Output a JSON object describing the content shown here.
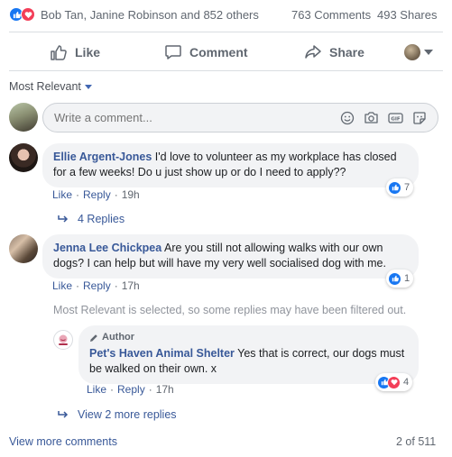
{
  "reactions": {
    "names": "Bob Tan, Janine Robinson and 852 others",
    "comments": "763 Comments",
    "shares": "493 Shares"
  },
  "actions": {
    "like": "Like",
    "comment": "Comment",
    "share": "Share"
  },
  "sort": {
    "label": "Most Relevant"
  },
  "composer": {
    "placeholder": "Write a comment..."
  },
  "comments": [
    {
      "name": "Ellie Argent-Jones",
      "text": "I'd love to volunteer as my workplace has closed for a few weeks! Do u just show up or do I need to apply??",
      "like": "Like",
      "reply": "Reply",
      "time": "19h",
      "reactions": "7",
      "replies": "4 Replies"
    },
    {
      "name": "Jenna Lee Chickpea",
      "text": "Are you still not allowing walks with our own dogs? I can help but will have my very well socialised dog with me.",
      "like": "Like",
      "reply": "Reply",
      "time": "17h",
      "reactions": "1",
      "filter_note": "Most Relevant is selected, so some replies may have been filtered out.",
      "reply_item": {
        "badge": "Author",
        "name": "Pet's Haven Animal Shelter",
        "text": "Yes that is correct, our dogs must be walked on their own. x",
        "like": "Like",
        "reply": "Reply",
        "time": "17h",
        "reactions": "4"
      },
      "more_replies": "View 2 more replies"
    }
  ],
  "footer": {
    "view_more": "View more comments",
    "count": "2 of 511"
  },
  "colors": {
    "like": "#1877f2",
    "love": "#f33e58",
    "link": "#385898",
    "bubble": "#f2f3f5"
  }
}
